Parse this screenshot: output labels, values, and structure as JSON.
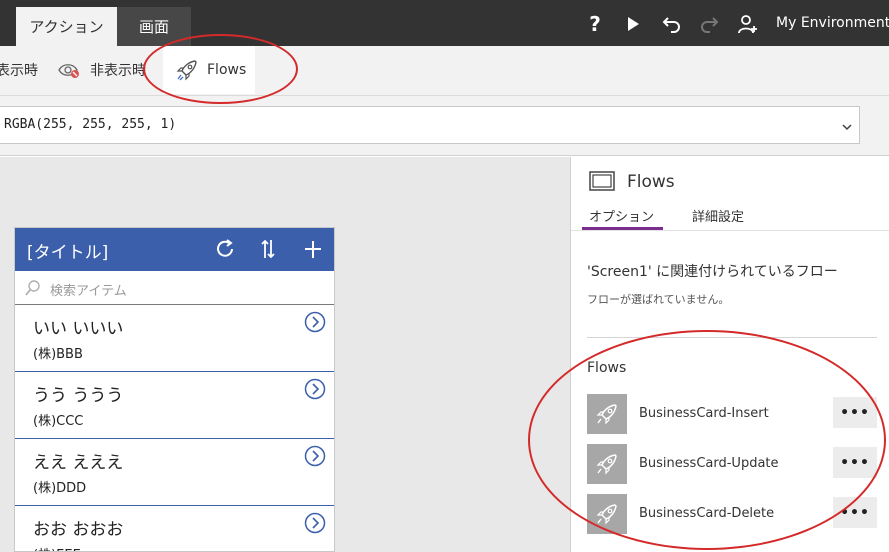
{
  "topbar": {
    "tabs": [
      {
        "label": "アクション",
        "active": true
      },
      {
        "label": "画面",
        "active": false
      }
    ],
    "help_label": "?",
    "environment": "My Environment"
  },
  "ribbon": {
    "visible_label": "表示時",
    "hidden_label": "非表示時",
    "flows_label": "Flows"
  },
  "formula": {
    "value": "RGBA(255, 255, 255, 1)"
  },
  "app": {
    "title": "[タイトル]",
    "search_placeholder": "検索アイテム",
    "items": [
      {
        "title": "いい いいい",
        "subtitle": "(株)BBB"
      },
      {
        "title": "うう ううう",
        "subtitle": "(株)CCC"
      },
      {
        "title": "ええ えええ",
        "subtitle": "(株)DDD"
      },
      {
        "title": "おお おおお",
        "subtitle": "(株)EEE"
      }
    ]
  },
  "panel": {
    "title": "Flows",
    "tabs": [
      {
        "label": "オプション",
        "active": true
      },
      {
        "label": "詳細設定",
        "active": false
      }
    ],
    "associated_title": "'Screen1' に関連付けられているフロー",
    "associated_empty": "フローが選ばれていません。",
    "flows_section_label": "Flows",
    "more_label": "•••",
    "flows": [
      {
        "name": "BusinessCard-Insert"
      },
      {
        "name": "BusinessCard-Update"
      },
      {
        "name": "BusinessCard-Delete"
      }
    ]
  },
  "colors": {
    "topbar": "#333333",
    "app_header": "#3b5fab",
    "tab_underline": "#7b2d8e",
    "annotation": "#d42a2a"
  }
}
